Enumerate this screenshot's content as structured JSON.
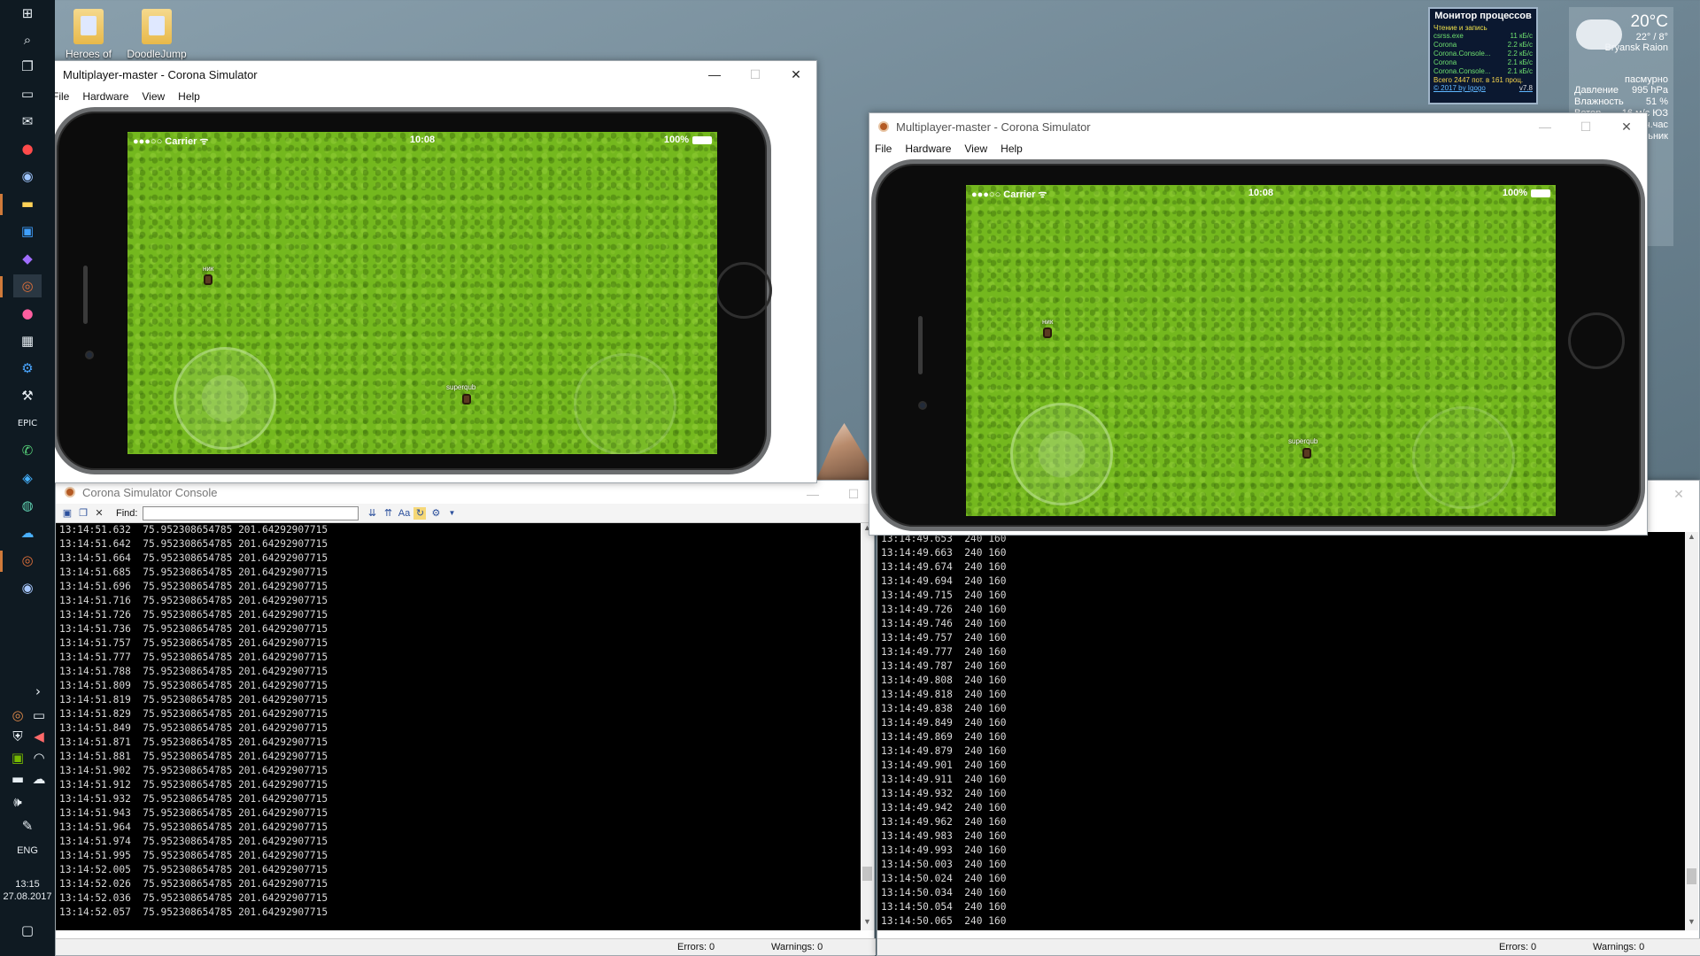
{
  "desktop": {
    "icons": [
      {
        "label": "Heroes of"
      },
      {
        "label": "DoodleJump"
      }
    ]
  },
  "taskbar": {
    "apps": [
      "start-icon",
      "search-icon",
      "task-view-icon",
      "monitor-icon",
      "mail-icon",
      "yandex-icon",
      "steam-icon",
      "folder-icon",
      "photoshop-icon",
      "visual-studio-icon",
      "corona-icon",
      "messenger-icon",
      "calculator-icon",
      "settings-icon",
      "tool-icon",
      "epic-icon",
      "chat-icon",
      "cube-icon",
      "globe-icon",
      "cloud-app-icon",
      "corona-console-icon",
      "network-app-icon"
    ],
    "language": "ENG",
    "time": "13:15",
    "date": "27.08.2017"
  },
  "process_monitor": {
    "title": "Монитор процессов",
    "header": "Чтение и запись",
    "rows": [
      {
        "name": "csrss.exe",
        "rate": "11 кБ/с"
      },
      {
        "name": "Corona",
        "rate": "2.2 кБ/с"
      },
      {
        "name": "Corona.Console...",
        "rate": "2.2 кБ/с"
      },
      {
        "name": "Corona",
        "rate": "2.1 кБ/с"
      },
      {
        "name": "Corona.Console...",
        "rate": "2.1 кБ/с"
      }
    ],
    "total": "Всего 2447 пот. в 161 проц.",
    "footer_link": "© 2017 by Igogo",
    "version": "v7.8"
  },
  "weather": {
    "temp": "20°C",
    "range": "22° / 8°",
    "city": "Bryansk Raion",
    "condition": "пасмурно",
    "rows": [
      {
        "label": "Давление",
        "value": "995 hPa"
      },
      {
        "label": "Влажность",
        "value": "51 %"
      },
      {
        "label": "Ветер",
        "value": "16 м/с ЮЗ"
      },
      {
        "label": "",
        "value": "ч.час"
      }
    ],
    "extra": "ьник"
  },
  "sim1": {
    "title": "Multiplayer-master - Corona Simulator",
    "menu": [
      "File",
      "Hardware",
      "View",
      "Help"
    ],
    "status": {
      "carrier": "●●●○○ Carrier ᯤ",
      "time": "10:08",
      "battery": "100%"
    },
    "players": [
      {
        "name": "ник"
      },
      {
        "name": "superqub"
      }
    ]
  },
  "sim2": {
    "title": "Multiplayer-master - Corona Simulator",
    "menu": [
      "File",
      "Hardware",
      "View",
      "Help"
    ],
    "status": {
      "carrier": "●●●○○ Carrier ᯤ",
      "time": "10:08",
      "battery": "100%"
    },
    "players": [
      {
        "name": "ник"
      },
      {
        "name": "superqub"
      }
    ]
  },
  "console1": {
    "title": "Corona Simulator Console",
    "find_label": "Find:",
    "find_value": "",
    "errors": "Errors: 0",
    "warnings": "Warnings: 0",
    "lines": [
      "13:14:51.632  75.952308654785 201.64292907715",
      "13:14:51.642  75.952308654785 201.64292907715",
      "13:14:51.664  75.952308654785 201.64292907715",
      "13:14:51.685  75.952308654785 201.64292907715",
      "13:14:51.696  75.952308654785 201.64292907715",
      "13:14:51.716  75.952308654785 201.64292907715",
      "13:14:51.726  75.952308654785 201.64292907715",
      "13:14:51.736  75.952308654785 201.64292907715",
      "13:14:51.757  75.952308654785 201.64292907715",
      "13:14:51.777  75.952308654785 201.64292907715",
      "13:14:51.788  75.952308654785 201.64292907715",
      "13:14:51.809  75.952308654785 201.64292907715",
      "13:14:51.819  75.952308654785 201.64292907715",
      "13:14:51.829  75.952308654785 201.64292907715",
      "13:14:51.849  75.952308654785 201.64292907715",
      "13:14:51.871  75.952308654785 201.64292907715",
      "13:14:51.881  75.952308654785 201.64292907715",
      "13:14:51.902  75.952308654785 201.64292907715",
      "13:14:51.912  75.952308654785 201.64292907715",
      "13:14:51.932  75.952308654785 201.64292907715",
      "13:14:51.943  75.952308654785 201.64292907715",
      "13:14:51.964  75.952308654785 201.64292907715",
      "13:14:51.974  75.952308654785 201.64292907715",
      "13:14:51.995  75.952308654785 201.64292907715",
      "13:14:52.005  75.952308654785 201.64292907715",
      "13:14:52.026  75.952308654785 201.64292907715",
      "13:14:52.036  75.952308654785 201.64292907715",
      "13:14:52.057  75.952308654785 201.64292907715"
    ]
  },
  "console2": {
    "errors": "Errors: 0",
    "warnings": "Warnings: 0",
    "lines": [
      "13:14:49.653  240 160",
      "13:14:49.663  240 160",
      "13:14:49.674  240 160",
      "13:14:49.694  240 160",
      "13:14:49.715  240 160",
      "13:14:49.726  240 160",
      "13:14:49.746  240 160",
      "13:14:49.757  240 160",
      "13:14:49.777  240 160",
      "13:14:49.787  240 160",
      "13:14:49.808  240 160",
      "13:14:49.818  240 160",
      "13:14:49.838  240 160",
      "13:14:49.849  240 160",
      "13:14:49.869  240 160",
      "13:14:49.879  240 160",
      "13:14:49.901  240 160",
      "13:14:49.911  240 160",
      "13:14:49.932  240 160",
      "13:14:49.942  240 160",
      "13:14:49.962  240 160",
      "13:14:49.983  240 160",
      "13:14:49.993  240 160",
      "13:14:50.003  240 160",
      "13:14:50.024  240 160",
      "13:14:50.034  240 160",
      "13:14:50.054  240 160",
      "13:14:50.065  240 160"
    ]
  },
  "colors": {
    "taskbar": "#0f1a22",
    "grass": "#74b81e",
    "console_bg": "#000000"
  }
}
